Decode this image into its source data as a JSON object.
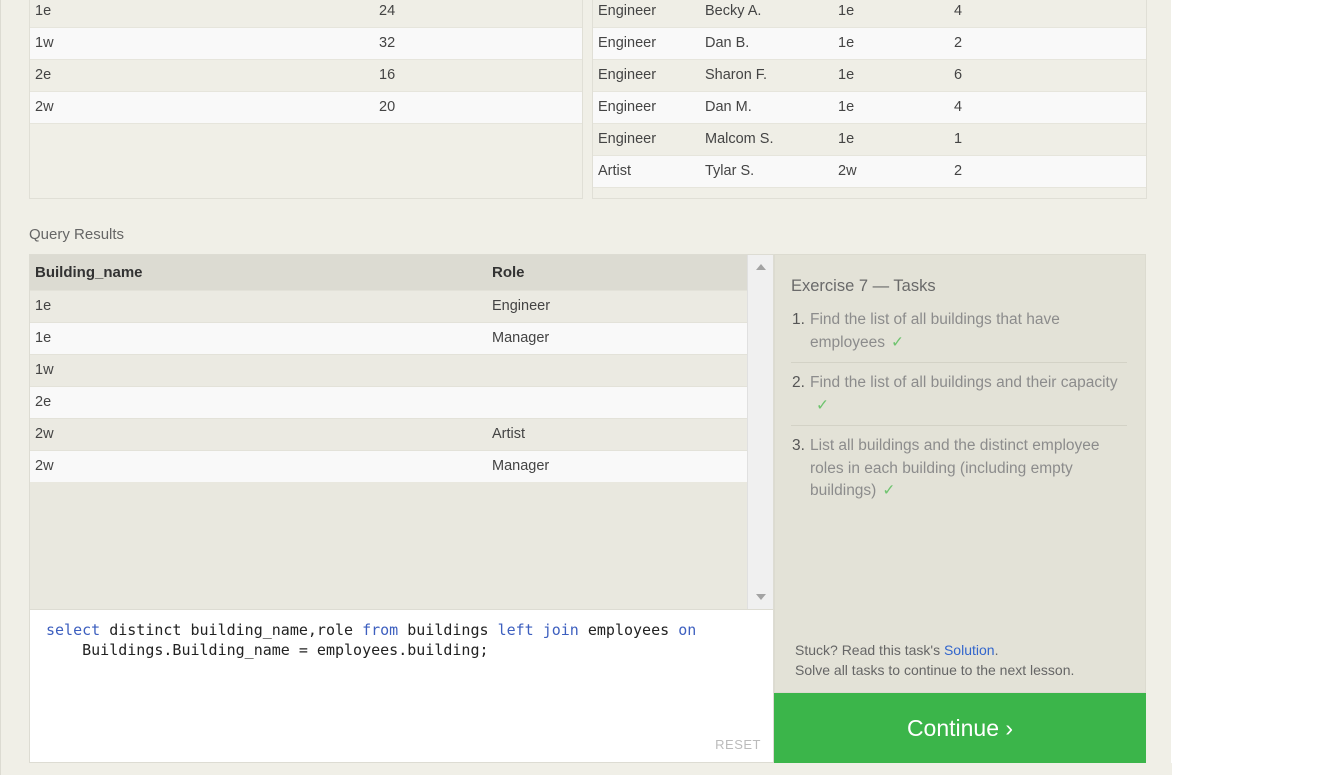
{
  "buildings_table": {
    "rows": [
      [
        "1e",
        "24"
      ],
      [
        "1w",
        "32"
      ],
      [
        "2e",
        "16"
      ],
      [
        "2w",
        "20"
      ]
    ]
  },
  "employees_table": {
    "rows": [
      [
        "Engineer",
        "Becky A.",
        "1e",
        "4"
      ],
      [
        "Engineer",
        "Dan B.",
        "1e",
        "2"
      ],
      [
        "Engineer",
        "Sharon F.",
        "1e",
        "6"
      ],
      [
        "Engineer",
        "Dan M.",
        "1e",
        "4"
      ],
      [
        "Engineer",
        "Malcom S.",
        "1e",
        "1"
      ],
      [
        "Artist",
        "Tylar S.",
        "2w",
        "2"
      ]
    ]
  },
  "query_results": {
    "label": "Query Results",
    "columns": [
      "Building_name",
      "Role"
    ],
    "rows": [
      [
        "1e",
        "Engineer"
      ],
      [
        "1e",
        "Manager"
      ],
      [
        "1w",
        ""
      ],
      [
        "2e",
        ""
      ],
      [
        "2w",
        "Artist"
      ],
      [
        "2w",
        "Manager"
      ]
    ]
  },
  "editor": {
    "reset_label": "RESET"
  },
  "tasks": {
    "title": "Exercise 7 — Tasks",
    "items": [
      {
        "num": "1.",
        "text": "Find the list of all buildings that have employees",
        "check": "✓"
      },
      {
        "num": "2.",
        "text": "Find the list of all buildings and their capacity",
        "check": "✓"
      },
      {
        "num": "3.",
        "text": "List all buildings and the distinct employee roles in each building (including empty buildings)",
        "check": "✓"
      }
    ],
    "stuck_prefix": "Stuck? Read this task's ",
    "solution_link": "Solution",
    "stuck_suffix": ".",
    "solve_all": "Solve all tasks to continue to the next lesson."
  },
  "continue_label": "Continue ›"
}
